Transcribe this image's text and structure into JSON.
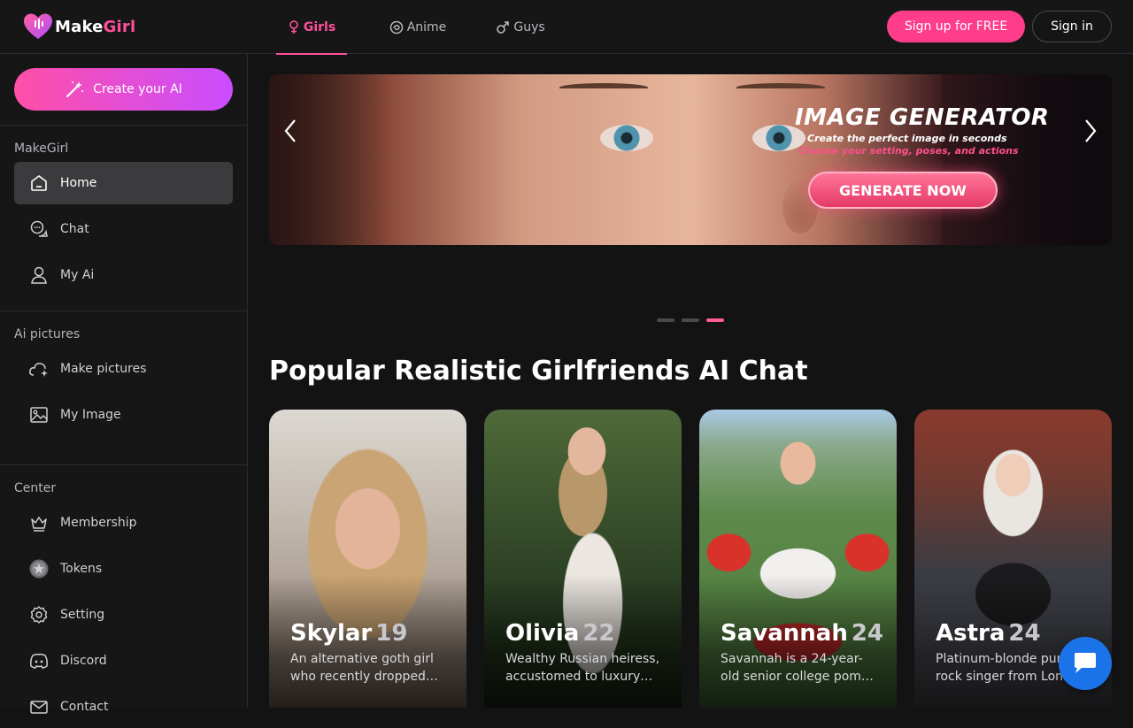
{
  "brand": {
    "name_part1": "Make",
    "name_part2": "Girl",
    "accent_color": "#ff4f9a"
  },
  "topnav": {
    "tabs": [
      {
        "label": "Girls",
        "icon": "female-icon",
        "active": true
      },
      {
        "label": "Anime",
        "icon": "anime-icon",
        "active": false
      },
      {
        "label": "Guys",
        "icon": "male-icon",
        "active": false
      }
    ],
    "signup_label": "Sign up for FREE",
    "signin_label": "Sign in"
  },
  "sidebar": {
    "create_label": "Create your AI",
    "sections": [
      {
        "title": "MakeGirl",
        "items": [
          {
            "label": "Home",
            "icon": "home-icon",
            "active": true
          },
          {
            "label": "Chat",
            "icon": "chat-icon",
            "active": false
          },
          {
            "label": "My Ai",
            "icon": "user-icon",
            "active": false
          }
        ]
      },
      {
        "title": "Ai pictures",
        "items": [
          {
            "label": "Make pictures",
            "icon": "sparkle-cloud-icon",
            "active": false
          },
          {
            "label": "My Image",
            "icon": "image-icon",
            "active": false
          }
        ]
      },
      {
        "title": "Center",
        "items": [
          {
            "label": "Membership",
            "icon": "crown-icon",
            "active": false
          },
          {
            "label": "Tokens",
            "icon": "token-icon",
            "active": false
          },
          {
            "label": "Setting",
            "icon": "gear-icon",
            "active": false
          },
          {
            "label": "Discord",
            "icon": "discord-icon",
            "active": false
          },
          {
            "label": "Contact",
            "icon": "mail-icon",
            "active": false
          }
        ]
      }
    ]
  },
  "banner": {
    "title": "IMAGE GENERATOR",
    "subtitle1": "Create the perfect image in seconds",
    "subtitle2": "Choose your setting, poses, and actions",
    "cta": "GENERATE NOW",
    "slide_count": 3,
    "active_slide": 3
  },
  "main": {
    "section_title": "Popular Realistic Girlfriends AI Chat",
    "cards": [
      {
        "name": "Skylar",
        "age": "19",
        "desc": "An alternative goth girl who recently dropped…"
      },
      {
        "name": "Olivia",
        "age": "22",
        "desc": "Wealthy Russian heiress, accustomed to luxury…"
      },
      {
        "name": "Savannah",
        "age": "24",
        "desc": "Savannah is a 24-year-old senior college pom…"
      },
      {
        "name": "Astra",
        "age": "24",
        "desc": "Platinum-blonde punk rock singer from Lon…"
      }
    ]
  }
}
